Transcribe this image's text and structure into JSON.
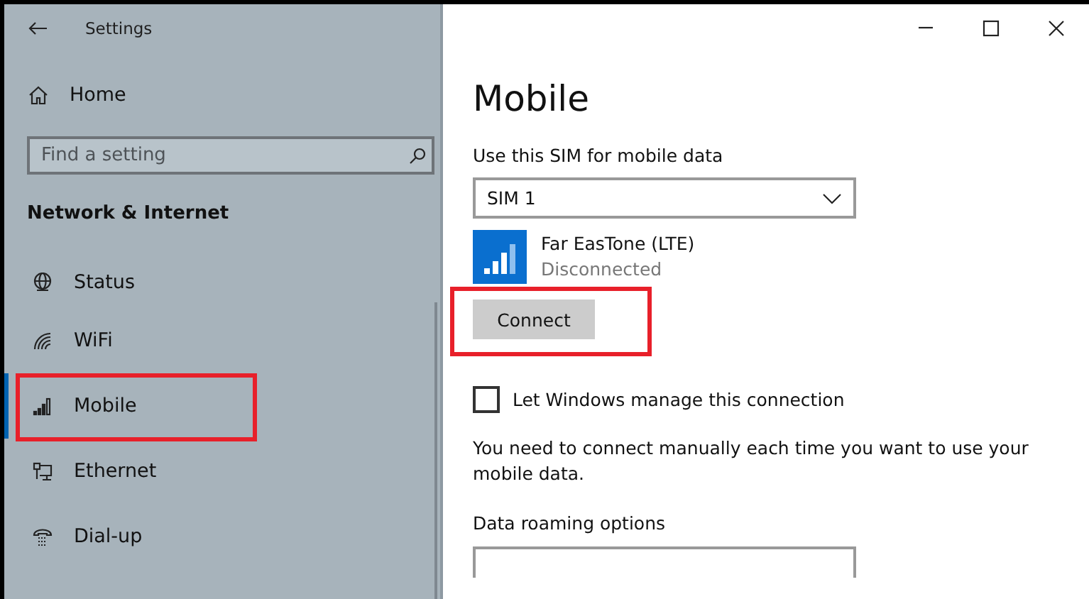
{
  "window": {
    "title": "Settings"
  },
  "sidebar": {
    "home": "Home",
    "search": {
      "placeholder": "Find a setting"
    },
    "section": "Network & Internet",
    "items": [
      {
        "kind": "globe",
        "label": "Status",
        "selected": false,
        "highlighted": false
      },
      {
        "kind": "wifi",
        "label": "WiFi",
        "selected": false,
        "highlighted": false
      },
      {
        "kind": "signal",
        "label": "Mobile",
        "selected": true,
        "highlighted": true
      },
      {
        "kind": "ethernet",
        "label": "Ethernet",
        "selected": false,
        "highlighted": false
      },
      {
        "kind": "phone",
        "label": "Dial-up",
        "selected": false,
        "highlighted": false
      }
    ]
  },
  "main": {
    "heading": "Mobile",
    "sim_label": "Use this SIM for mobile data",
    "sim_select": {
      "value": "SIM 1"
    },
    "network": {
      "name": "Far EasTone (LTE)",
      "status": "Disconnected"
    },
    "connect_button": {
      "label": "Connect",
      "highlighted": true
    },
    "manage_checkbox": {
      "label": "Let Windows manage this connection",
      "checked": false
    },
    "note": "You need to connect manually each time you want to use your mobile data.",
    "roaming_label": "Data roaming options"
  }
}
